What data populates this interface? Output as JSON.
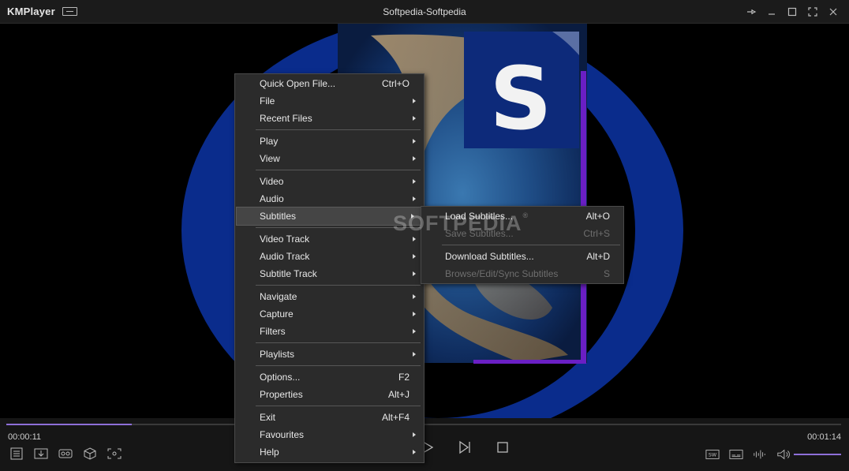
{
  "app": {
    "name": "KMPlayer",
    "window_title": "Softpedia-Softpedia"
  },
  "playback": {
    "current_time": "00:00:11",
    "total_time": "00:01:14",
    "progress_fraction": 0.15,
    "volume_fraction": 1.0
  },
  "menu": {
    "items": [
      {
        "label": "Quick Open File...",
        "shortcut": "Ctrl+O"
      },
      {
        "label": "File",
        "shortcut": ""
      },
      {
        "label": "Recent Files",
        "shortcut": ""
      },
      {
        "label": "Play",
        "shortcut": ""
      },
      {
        "label": "View",
        "shortcut": ""
      },
      {
        "label": "Video",
        "shortcut": ""
      },
      {
        "label": "Audio",
        "shortcut": ""
      },
      {
        "label": "Subtitles",
        "shortcut": ""
      },
      {
        "label": "Video Track",
        "shortcut": ""
      },
      {
        "label": "Audio Track",
        "shortcut": ""
      },
      {
        "label": "Subtitle Track",
        "shortcut": ""
      },
      {
        "label": "Navigate",
        "shortcut": ""
      },
      {
        "label": "Capture",
        "shortcut": ""
      },
      {
        "label": "Filters",
        "shortcut": ""
      },
      {
        "label": "Playlists",
        "shortcut": ""
      },
      {
        "label": "Options...",
        "shortcut": "F2"
      },
      {
        "label": "Properties",
        "shortcut": "Alt+J"
      },
      {
        "label": "Exit",
        "shortcut": "Alt+F4"
      },
      {
        "label": "Favourites",
        "shortcut": ""
      },
      {
        "label": "Help",
        "shortcut": ""
      }
    ]
  },
  "submenu": {
    "items": [
      {
        "label": "Load Subtitles...",
        "shortcut": "Alt+O"
      },
      {
        "label": "Save Subtitles...",
        "shortcut": "Ctrl+S"
      },
      {
        "label": "Download Subtitles...",
        "shortcut": "Alt+D"
      },
      {
        "label": "Browse/Edit/Sync Subtitles",
        "shortcut": "S"
      }
    ]
  },
  "watermark": {
    "text": "SOFTPEDIA",
    "mark": "®"
  },
  "controls": {
    "ratio_label": "SW"
  },
  "colors": {
    "accent": "#8e6fd8",
    "logo_blue": "#0a2c8c"
  }
}
